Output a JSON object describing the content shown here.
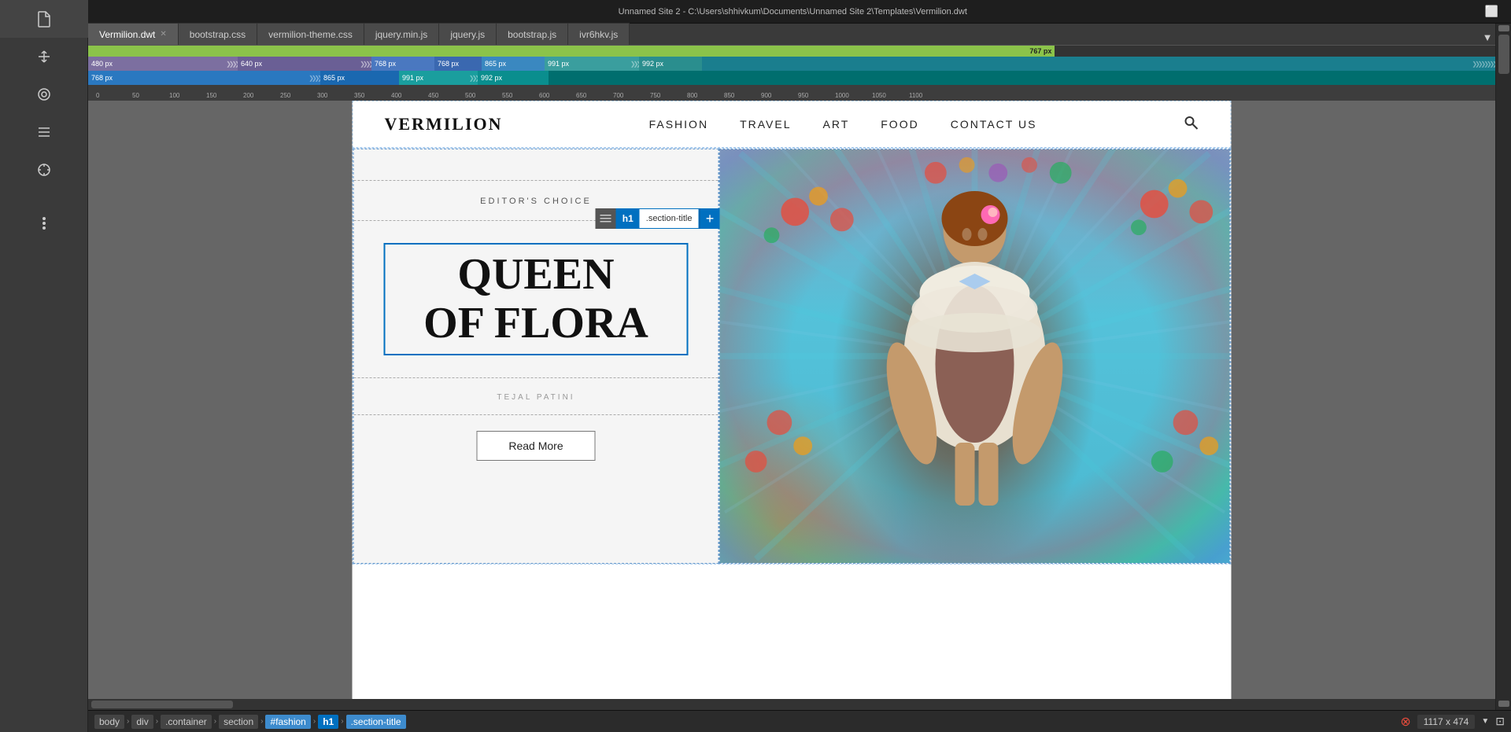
{
  "titleBar": {
    "text": "Unnamed Site 2 - C:\\Users\\shhivkum\\Documents\\Unnamed Site 2\\Templates\\Vermilion.dwt",
    "iconLabel": "restore"
  },
  "tabs": [
    {
      "id": "tab-vermilion",
      "label": "Vermilion.dwt",
      "active": true,
      "closable": true
    },
    {
      "id": "tab-bootstrap-css",
      "label": "bootstrap.css",
      "active": false
    },
    {
      "id": "tab-vermilion-theme",
      "label": "vermilion-theme.css",
      "active": false
    },
    {
      "id": "tab-jquery-min",
      "label": "jquery.min.js",
      "active": false
    },
    {
      "id": "tab-jquery",
      "label": "jquery.js",
      "active": false
    },
    {
      "id": "tab-bootstrap-js",
      "label": "bootstrap.js",
      "active": false
    },
    {
      "id": "tab-ivr6hkv",
      "label": "ivr6hkv.js",
      "active": false
    }
  ],
  "progressBar": {
    "value": 767,
    "max": 1117,
    "label": "767 px",
    "fillPercent": "68.7"
  },
  "breakpoints": [
    {
      "id": "bp-480",
      "label": "480 px",
      "color": "#7c6fa0"
    },
    {
      "id": "bp-640",
      "label": "640 px",
      "color": "#7c6fa0"
    },
    {
      "id": "bp-768a",
      "label": "768 px",
      "color": "#5a7abf"
    },
    {
      "id": "bp-768b",
      "label": "768 px",
      "color": "#4a90c0"
    },
    {
      "id": "bp-865",
      "label": "865 px",
      "color": "#4a90c0"
    },
    {
      "id": "bp-991",
      "label": "991 px",
      "color": "#5a9ea0"
    },
    {
      "id": "bp-992",
      "label": "992 px",
      "color": "#5a9ea0"
    }
  ],
  "ruler": {
    "ticks": [
      0,
      50,
      100,
      150,
      200,
      250,
      300,
      350,
      400,
      450,
      500,
      550,
      600,
      650,
      700,
      750,
      800,
      850,
      900,
      950,
      1000,
      1050,
      1100
    ]
  },
  "toolbar": {
    "icons": [
      "☰",
      "⇅",
      "◎",
      "≡",
      "✛",
      "⋯"
    ]
  },
  "website": {
    "logo": "VERMILION",
    "nav": {
      "items": [
        "FASHION",
        "TRAVEL",
        "ART",
        "FOOD",
        "CONTACT US"
      ]
    },
    "searchIcon": "🔍",
    "hero": {
      "editorsChoice": "EDITOR'S CHOICE",
      "title": "QUEEN\nOF FLORA",
      "author": "TEJAL PATINI",
      "readMoreLabel": "Read More"
    }
  },
  "elementTooltip": {
    "menuIcon": "≡",
    "tag": "h1",
    "className": ".section-title",
    "plusIcon": "+"
  },
  "bottomBar": {
    "breadcrumbs": [
      "body",
      "div",
      ".container",
      "section",
      "#fashion",
      "h1",
      ".section-title"
    ],
    "activeIndex": 5,
    "dimensions": "1117 x 474",
    "errorIcon": "⊗"
  },
  "filterIcon": "▼",
  "scrollbarV": {
    "visible": true
  },
  "scrollbarH": {
    "visible": true
  }
}
